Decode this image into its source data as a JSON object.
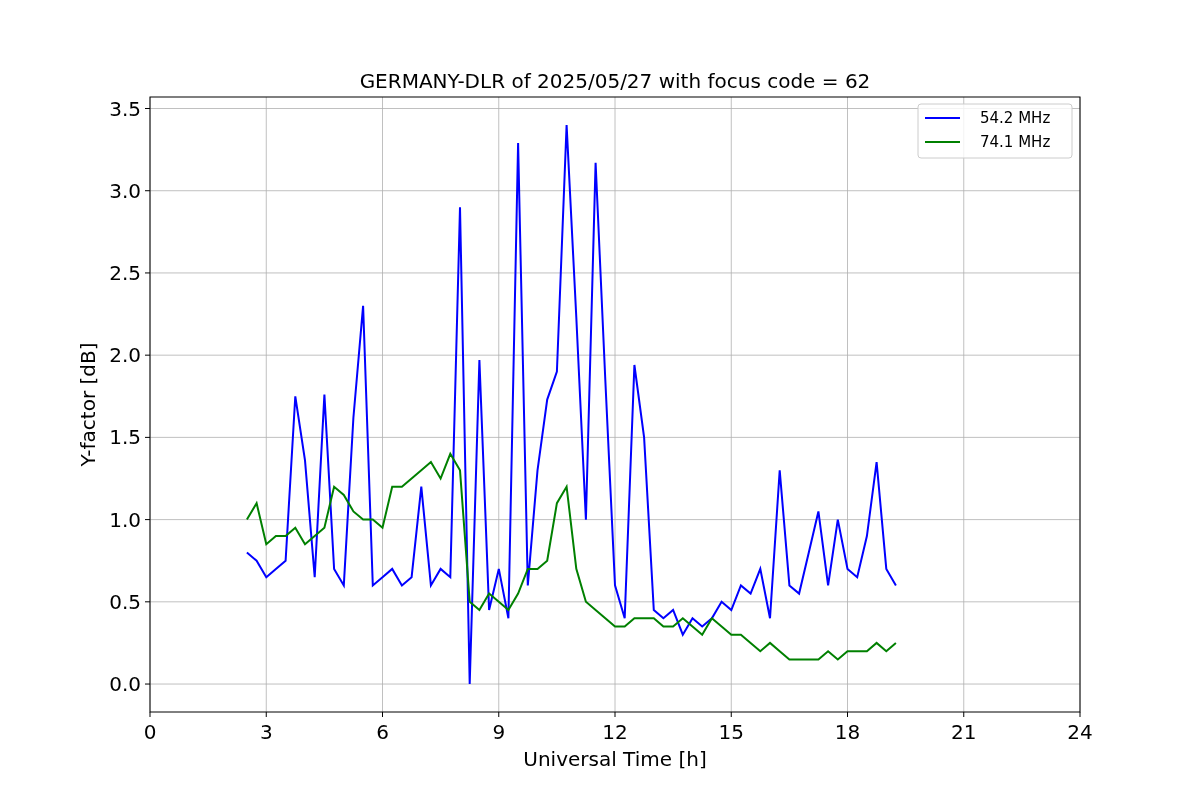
{
  "chart_data": {
    "type": "line",
    "title": "GERMANY-DLR of 2025/05/27 with focus code = 62",
    "xlabel": "Universal Time [h]",
    "ylabel": "Y-factor [dB]",
    "x": [
      2.5,
      2.75,
      3.0,
      3.25,
      3.5,
      3.75,
      4.0,
      4.25,
      4.5,
      4.75,
      5.0,
      5.25,
      5.5,
      5.75,
      6.0,
      6.25,
      6.5,
      6.75,
      7.0,
      7.25,
      7.5,
      7.75,
      8.0,
      8.25,
      8.5,
      8.75,
      9.0,
      9.25,
      9.5,
      9.75,
      10.0,
      10.25,
      10.5,
      10.75,
      11.0,
      11.25,
      11.5,
      11.75,
      12.0,
      12.25,
      12.5,
      12.75,
      13.0,
      13.25,
      13.5,
      13.75,
      14.0,
      14.25,
      14.5,
      14.75,
      15.0,
      15.25,
      15.5,
      15.75,
      16.0,
      16.25,
      16.5,
      16.75,
      17.0,
      17.25,
      17.5,
      17.75,
      18.0,
      18.25,
      18.5,
      18.75,
      19.0,
      19.25
    ],
    "series": [
      {
        "name": "54.2 MHz",
        "color": "#0000ff",
        "values": [
          0.8,
          0.75,
          0.65,
          0.7,
          0.75,
          1.75,
          1.36,
          0.65,
          1.76,
          0.7,
          0.6,
          1.62,
          2.3,
          0.6,
          0.65,
          0.7,
          0.6,
          0.65,
          1.2,
          0.6,
          0.7,
          0.65,
          2.9,
          0.0,
          1.97,
          0.45,
          0.7,
          0.4,
          3.29,
          0.6,
          1.3,
          1.73,
          1.9,
          3.4,
          2.23,
          1.0,
          3.17,
          1.85,
          0.6,
          0.4,
          1.94,
          1.5,
          0.45,
          0.4,
          0.45,
          0.3,
          0.4,
          0.35,
          0.4,
          0.5,
          0.45,
          0.6,
          0.55,
          0.7,
          0.4,
          1.3,
          0.6,
          0.55,
          0.8,
          1.05,
          0.6,
          1.0,
          0.7,
          0.65,
          0.9,
          1.35,
          0.7,
          0.6
        ]
      },
      {
        "name": "74.1 MHz",
        "color": "#008000",
        "values": [
          1.0,
          1.1,
          0.85,
          0.9,
          0.9,
          0.95,
          0.85,
          0.9,
          0.95,
          1.2,
          1.15,
          1.05,
          1.0,
          1.0,
          0.95,
          1.2,
          1.2,
          1.25,
          1.3,
          1.35,
          1.25,
          1.4,
          1.3,
          0.5,
          0.45,
          0.55,
          0.5,
          0.45,
          0.55,
          0.7,
          0.7,
          0.75,
          1.1,
          1.2,
          0.7,
          0.5,
          0.45,
          0.4,
          0.35,
          0.35,
          0.4,
          0.4,
          0.4,
          0.35,
          0.35,
          0.4,
          0.35,
          0.3,
          0.4,
          0.35,
          0.3,
          0.3,
          0.25,
          0.2,
          0.25,
          0.2,
          0.15,
          0.15,
          0.15,
          0.15,
          0.2,
          0.15,
          0.2,
          0.2,
          0.2,
          0.25,
          0.2,
          0.25
        ]
      }
    ],
    "grid": true,
    "legend": true,
    "xlim": [
      0,
      24
    ],
    "ylim": [
      -0.17,
      3.57
    ],
    "xticks": [
      0,
      3,
      6,
      9,
      12,
      15,
      18,
      21,
      24
    ],
    "yticks": [
      {
        "value": 0,
        "label": "0.0"
      },
      {
        "value": 0.5,
        "label": "0.5"
      },
      {
        "value": 1,
        "label": "1.0"
      },
      {
        "value": 1.5,
        "label": "1.5"
      },
      {
        "value": 2,
        "label": "2.0"
      },
      {
        "value": 2.5,
        "label": "2.5"
      },
      {
        "value": 3,
        "label": "3.0"
      },
      {
        "value": 3.5,
        "label": "3.5"
      }
    ]
  }
}
